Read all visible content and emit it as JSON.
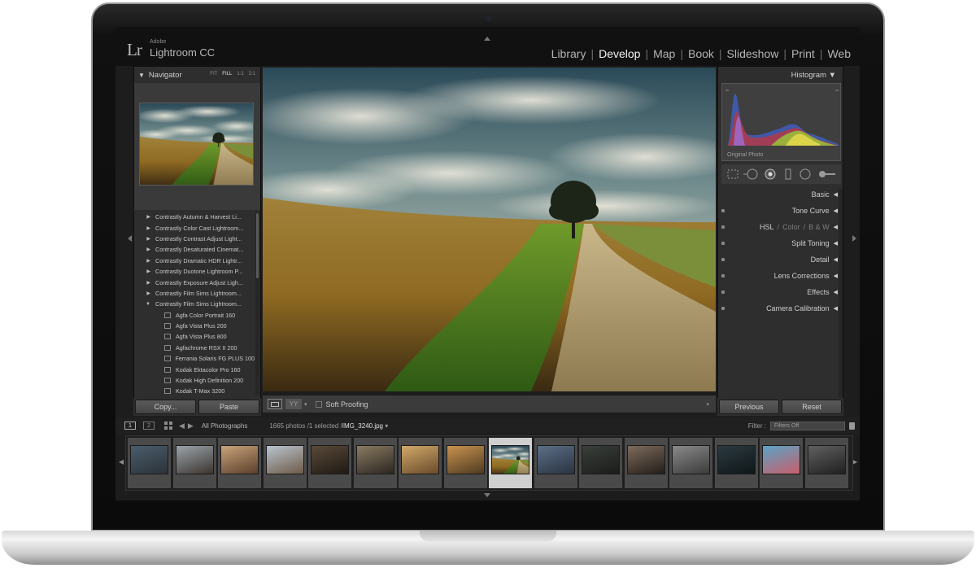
{
  "app": {
    "logo_mark": "Lr",
    "logo_vendor": "Adobe",
    "logo_name": "Lightroom CC"
  },
  "modules": [
    "Library",
    "Develop",
    "Map",
    "Book",
    "Slideshow",
    "Print",
    "Web"
  ],
  "active_module": "Develop",
  "navigator": {
    "title": "Navigator",
    "zoom_options": [
      "FIT",
      "FILL",
      "1:1",
      "2:1"
    ],
    "selected_zoom": "FILL"
  },
  "presets": [
    {
      "label": "Contrastly Autumn & Harvest Li...",
      "type": "folder",
      "open": false
    },
    {
      "label": "Contrastly Color Cast Lightroom...",
      "type": "folder",
      "open": false
    },
    {
      "label": "Contrastly Contrast Adjust Light...",
      "type": "folder",
      "open": false
    },
    {
      "label": "Contrastly Desaturated Cinemat...",
      "type": "folder",
      "open": false
    },
    {
      "label": "Contrastly Dramatic HDR Lightr...",
      "type": "folder",
      "open": false
    },
    {
      "label": "Contrastly Duotone Lightroom P...",
      "type": "folder",
      "open": false
    },
    {
      "label": "Contrastly Exposure Adjust Ligh...",
      "type": "folder",
      "open": false
    },
    {
      "label": "Contrastly Film Sims Lightroom...",
      "type": "folder",
      "open": false
    },
    {
      "label": "Contrastly Film Sims Lightroom...",
      "type": "folder",
      "open": true
    },
    {
      "label": "Agfa Color Portrait 160",
      "type": "preset"
    },
    {
      "label": "Agfa Vista Plus 200",
      "type": "preset"
    },
    {
      "label": "Agfa Vista Plus 800",
      "type": "preset"
    },
    {
      "label": "Agfachrome RSX II 200",
      "type": "preset"
    },
    {
      "label": "Ferrania Solaris FG PLUS 100",
      "type": "preset"
    },
    {
      "label": "Kodak Ektacolor Pro 160",
      "type": "preset"
    },
    {
      "label": "Kodak High Definition 200",
      "type": "preset"
    },
    {
      "label": "Kodak T-Max 3200",
      "type": "preset"
    }
  ],
  "left_buttons": {
    "copy": "Copy...",
    "paste": "Paste"
  },
  "toolbar": {
    "yy_label": "YY",
    "soft_proofing": "Soft Proofing"
  },
  "histogram": {
    "title": "Histogram",
    "caption": "Original Photo"
  },
  "develop_sections": {
    "basic": "Basic",
    "tone_curve": "Tone Curve",
    "hsl": "HSL",
    "hsl_sep": "/",
    "color": "Color",
    "bw": "B & W",
    "split_toning": "Split Toning",
    "detail": "Detail",
    "lens_corrections": "Lens Corrections",
    "effects": "Effects",
    "camera_calibration": "Camera Calibration"
  },
  "right_buttons": {
    "previous": "Previous",
    "reset": "Reset"
  },
  "filmstrip": {
    "view1": "1",
    "view2": "2",
    "source": "All Photographs",
    "count_prefix": "1665 photos /1 selected /",
    "filename": "IMG_3240.jpg",
    "filter_label": "Filter :",
    "filter_value": "Filters Off",
    "selected_index": 8,
    "thumbnail_count": 16
  },
  "colors": {
    "panel": "#2e2e2e",
    "topbar": "#111111",
    "active_module": "#f2f2f2",
    "inactive_module": "#b4b4b4"
  }
}
